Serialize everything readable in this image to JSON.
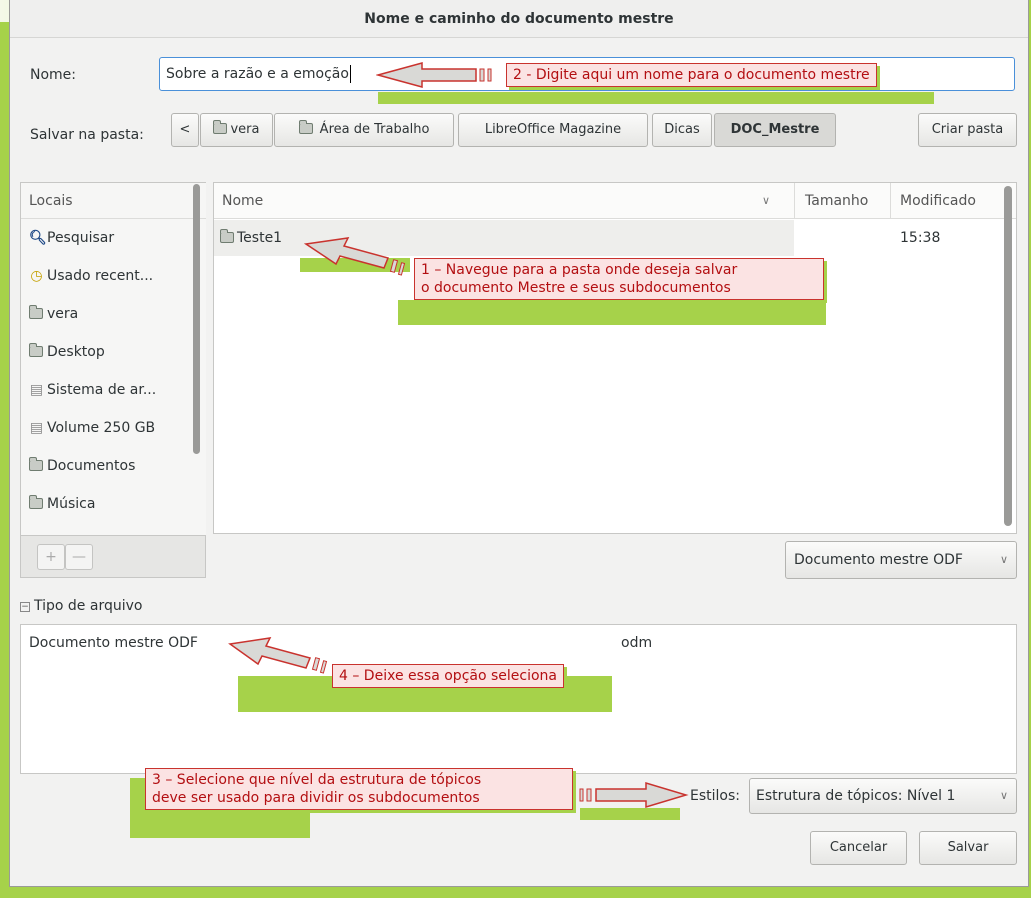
{
  "dialog": {
    "title": "Nome e caminho do documento mestre"
  },
  "name_row": {
    "label": "Nome:",
    "value": "Sobre a razão e a emoção"
  },
  "folder_row": {
    "label": "Salvar na pasta:",
    "back_glyph": "<",
    "crumbs": [
      "vera",
      "Área de Trabalho",
      "LibreOffice Magazine",
      "Dicas",
      "DOC_Mestre"
    ],
    "create_folder": "Criar pasta"
  },
  "places": {
    "header": "Locais",
    "items": [
      {
        "icon": "search-icon",
        "label": "Pesquisar"
      },
      {
        "icon": "recent-icon",
        "label": "Usado recent..."
      },
      {
        "icon": "home-folder-icon",
        "label": "vera"
      },
      {
        "icon": "desktop-folder-icon",
        "label": "Desktop"
      },
      {
        "icon": "drive-icon",
        "label": "Sistema de ar..."
      },
      {
        "icon": "drive-icon",
        "label": "Volume 250 GB"
      },
      {
        "icon": "documents-folder-icon",
        "label": "Documentos"
      },
      {
        "icon": "music-folder-icon",
        "label": "Música"
      }
    ],
    "add": "+",
    "remove": "—"
  },
  "files": {
    "col_name": "Nome",
    "col_size": "Tamanho",
    "col_modified": "Modificado",
    "rows": [
      {
        "name": "Teste1",
        "size": "",
        "modified": "15:38"
      }
    ]
  },
  "filter": {
    "value": "Documento mestre ODF"
  },
  "file_type": {
    "expander": "Tipo de arquivo",
    "name": "Documento mestre ODF",
    "ext": "odm"
  },
  "styles": {
    "label": "Estilos:",
    "value": "Estrutura de tópicos: Nível 1"
  },
  "buttons": {
    "cancel": "Cancelar",
    "save": "Salvar"
  },
  "annotations": {
    "step1_line1": "1 – Navegue para a pasta onde deseja salvar",
    "step1_line2": "o documento Mestre e seus subdocumentos",
    "step2": "2 - Digite aqui um nome para o documento mestre",
    "step3_line1": "3 – Selecione que nível da estrutura de tópicos",
    "step3_line2": "deve ser usado para dividir os subdocumentos",
    "step4": "4 – Deixe essa opção seleciona"
  },
  "colors": {
    "accent_green": "#a6d24a",
    "annotation_red": "#c9332e",
    "annotation_fill": "#fbe3e3"
  }
}
